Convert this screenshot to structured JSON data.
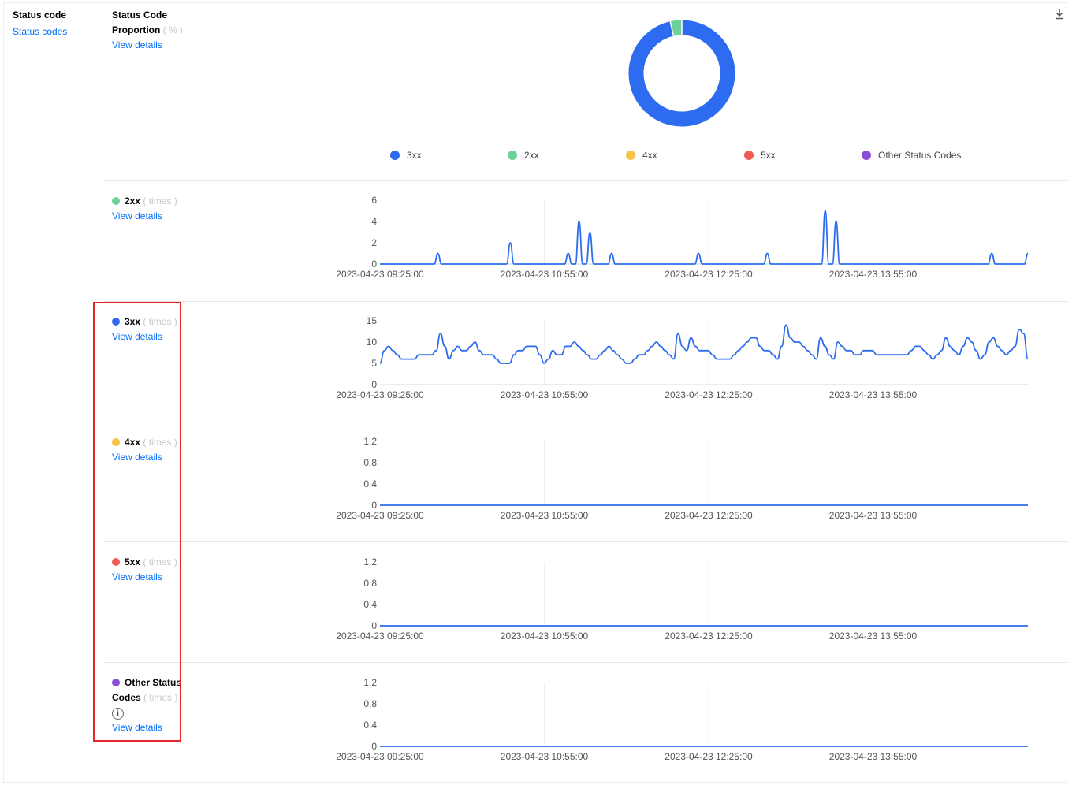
{
  "sidebar": {
    "title": "Status code",
    "link": "Status codes"
  },
  "proportion": {
    "title_line1": "Status Code",
    "title_line2": "Proportion",
    "unit": "( % )",
    "link": "View details",
    "download_icon": "download-icon",
    "legend": [
      {
        "label": "3xx",
        "color": "#2d6cf0"
      },
      {
        "label": "2xx",
        "color": "#6fd09a"
      },
      {
        "label": "4xx",
        "color": "#f6c346"
      },
      {
        "label": "5xx",
        "color": "#ee5e55"
      },
      {
        "label": "Other Status Codes",
        "color": "#8b4ed8"
      }
    ]
  },
  "panels": [
    {
      "title": "2xx",
      "unit": "( times )",
      "link": "View details",
      "color": "#6fd09a"
    },
    {
      "title": "3xx",
      "unit": "( times )",
      "link": "View details",
      "color": "#2d6cf0"
    },
    {
      "title": "4xx",
      "unit": "( times )",
      "link": "View details",
      "color": "#f6c346"
    },
    {
      "title": "5xx",
      "unit": "( times )",
      "link": "View details",
      "color": "#ee5e55"
    },
    {
      "title_line1": "Other Status",
      "title_line2": "Codes",
      "unit": "( times )",
      "link": "View details",
      "color": "#8b4ed8",
      "info_icon": "info-icon"
    }
  ],
  "chart_data": [
    {
      "type": "pie",
      "donut": true,
      "categories": [
        "3xx",
        "2xx",
        "4xx",
        "5xx",
        "Other Status Codes"
      ],
      "values": [
        96.5,
        3.5,
        0,
        0,
        0
      ],
      "colors": [
        "#2d6cf0",
        "#6fd09a",
        "#f6c346",
        "#ee5e55",
        "#8b4ed8"
      ],
      "legend": "bottom"
    },
    {
      "type": "line",
      "series": [
        {
          "values": [
            0,
            0,
            0,
            0,
            0,
            0,
            0,
            0,
            0,
            0,
            0,
            0,
            0,
            0,
            0,
            0,
            1,
            0,
            0,
            0,
            0,
            0,
            0,
            0,
            0,
            0,
            0,
            0,
            0,
            0,
            0,
            0,
            0,
            0,
            0,
            0,
            2,
            0,
            0,
            0,
            0,
            0,
            0,
            0,
            0,
            0,
            0,
            0,
            0,
            0,
            0,
            0,
            1,
            0,
            0,
            4,
            0,
            0,
            3,
            0,
            0,
            0,
            0,
            0,
            1,
            0,
            0,
            0,
            0,
            0,
            0,
            0,
            0,
            0,
            0,
            0,
            0,
            0,
            0,
            0,
            0,
            0,
            0,
            0,
            0,
            0,
            0,
            0,
            1,
            0,
            0,
            0,
            0,
            0,
            0,
            0,
            0,
            0,
            0,
            0,
            0,
            0,
            0,
            0,
            0,
            0,
            0,
            1,
            0,
            0,
            0,
            0,
            0,
            0,
            0,
            0,
            0,
            0,
            0,
            0,
            0,
            0,
            0,
            5,
            0,
            0,
            4,
            0,
            0,
            0,
            0,
            0,
            0,
            0,
            0,
            0,
            0,
            0,
            0,
            0,
            0,
            0,
            0,
            0,
            0,
            0,
            0,
            0,
            0,
            0,
            0,
            0,
            0,
            0,
            0,
            0,
            0,
            0,
            0,
            0,
            0,
            0,
            0,
            0,
            0,
            0,
            0,
            0,
            0,
            1,
            0,
            0,
            0,
            0,
            0,
            0,
            0,
            0,
            0,
            1
          ]
        }
      ],
      "ylim": [
        0,
        6
      ],
      "yticks": [
        "0",
        "2",
        "4",
        "6"
      ],
      "xticks": [
        "2023-04-23 09:25:00",
        "2023-04-23 10:55:00",
        "2023-04-23 12:25:00",
        "2023-04-23 13:55:00"
      ]
    },
    {
      "type": "line",
      "series": [
        {
          "values": [
            5,
            8,
            9,
            8,
            7,
            6,
            6,
            6,
            6,
            7,
            7,
            7,
            7,
            8,
            12,
            9,
            6,
            8,
            9,
            8,
            8,
            9,
            10,
            8,
            7,
            7,
            7,
            6,
            5,
            5,
            5,
            7,
            8,
            8,
            9,
            9,
            9,
            7,
            5,
            6,
            8,
            7,
            7,
            9,
            9,
            10,
            9,
            8,
            7,
            6,
            6,
            7,
            8,
            9,
            8,
            7,
            6,
            5,
            5,
            6,
            7,
            7,
            8,
            9,
            10,
            9,
            8,
            7,
            6,
            12,
            9,
            8,
            11,
            9,
            8,
            8,
            8,
            7,
            6,
            6,
            6,
            6,
            7,
            8,
            9,
            10,
            11,
            11,
            9,
            8,
            8,
            7,
            6,
            9,
            14,
            11,
            10,
            10,
            9,
            8,
            7,
            6,
            11,
            9,
            7,
            6,
            10,
            9,
            8,
            8,
            7,
            7,
            8,
            8,
            8,
            7,
            7,
            7,
            7,
            7,
            7,
            7,
            7,
            8,
            9,
            9,
            8,
            7,
            6,
            7,
            8,
            11,
            9,
            8,
            7,
            9,
            11,
            10,
            8,
            6,
            7,
            10,
            11,
            9,
            8,
            7,
            8,
            9,
            13,
            12,
            6
          ]
        }
      ],
      "ylim": [
        0,
        15
      ],
      "yticks": [
        "0",
        "5",
        "10",
        "15"
      ],
      "xticks": [
        "2023-04-23 09:25:00",
        "2023-04-23 10:55:00",
        "2023-04-23 12:25:00",
        "2023-04-23 13:55:00"
      ]
    },
    {
      "type": "line",
      "series": [
        {
          "values": [
            0,
            0,
            0,
            0,
            0,
            0,
            0,
            0,
            0,
            0
          ]
        }
      ],
      "ylim": [
        0,
        1.2
      ],
      "yticks": [
        "0",
        "0.4",
        "0.8",
        "1.2"
      ],
      "xticks": [
        "2023-04-23 09:25:00",
        "2023-04-23 10:55:00",
        "2023-04-23 12:25:00",
        "2023-04-23 13:55:00"
      ]
    },
    {
      "type": "line",
      "series": [
        {
          "values": [
            0,
            0,
            0,
            0,
            0,
            0,
            0,
            0,
            0,
            0
          ]
        }
      ],
      "ylim": [
        0,
        1.2
      ],
      "yticks": [
        "0",
        "0.4",
        "0.8",
        "1.2"
      ],
      "xticks": [
        "2023-04-23 09:25:00",
        "2023-04-23 10:55:00",
        "2023-04-23 12:25:00",
        "2023-04-23 13:55:00"
      ]
    },
    {
      "type": "line",
      "series": [
        {
          "values": [
            0,
            0,
            0,
            0,
            0,
            0,
            0,
            0,
            0,
            0
          ]
        }
      ],
      "ylim": [
        0,
        1.2
      ],
      "yticks": [
        "0",
        "0.4",
        "0.8",
        "1.2"
      ],
      "xticks": [
        "2023-04-23 09:25:00",
        "2023-04-23 10:55:00",
        "2023-04-23 12:25:00",
        "2023-04-23 13:55:00"
      ]
    }
  ]
}
